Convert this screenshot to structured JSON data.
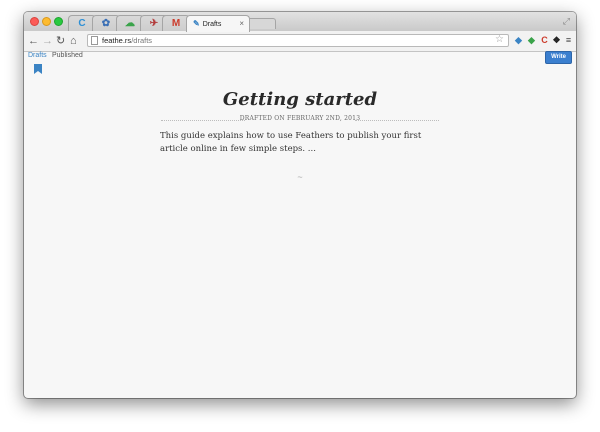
{
  "browser": {
    "tabs": [
      {
        "glyph": "C",
        "color": "#2d8fd5"
      },
      {
        "glyph": "✿",
        "color": "#3a6fb5"
      },
      {
        "glyph": "☁",
        "color": "#3aa34a"
      },
      {
        "glyph": "✈",
        "color": "#b23a3a"
      },
      {
        "glyph": "M",
        "color": "#cc3b2b"
      }
    ],
    "active_tab": {
      "title": "Drafts",
      "close": "×"
    },
    "url_host": "feathe.rs",
    "url_path": "/drafts",
    "extensions": [
      {
        "glyph": "◆",
        "color": "#3b84c4"
      },
      {
        "glyph": "◆",
        "color": "#3aa34a"
      },
      {
        "glyph": "C",
        "color": "#cc3b2b"
      },
      {
        "glyph": "❖",
        "color": "#222222"
      },
      {
        "glyph": "≡",
        "color": "#444444"
      }
    ]
  },
  "nav": {
    "drafts": "Drafts",
    "published": "Published",
    "write": "Write"
  },
  "article": {
    "title": "Getting started",
    "dateline": "DRAFTED ON FEBRUARY 2ND, 2013",
    "excerpt": "This guide explains how to use Feathers to publish your first article online in few simple steps. ...",
    "separator": "~"
  },
  "colors": {
    "accent": "#3b84c4",
    "write_button": "#3b7fcf"
  }
}
